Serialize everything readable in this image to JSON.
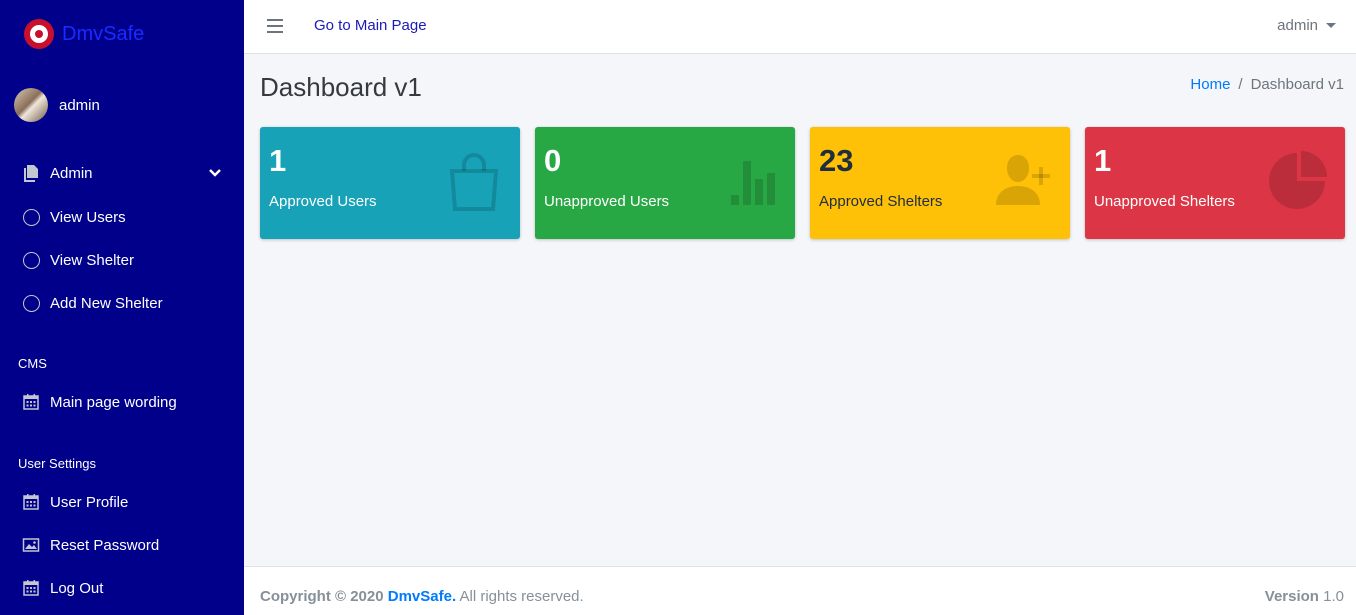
{
  "sidebar": {
    "brand": "DmvSafe",
    "user": "admin",
    "menu": [
      {
        "label": "Admin"
      },
      {
        "label": "View Users"
      },
      {
        "label": "View Shelter"
      },
      {
        "label": "Add New Shelter"
      }
    ],
    "cms_header": "CMS",
    "cms_items": [
      {
        "label": "Main page wording"
      }
    ],
    "settings_header": "User Settings",
    "settings_items": [
      {
        "label": "User Profile"
      },
      {
        "label": "Reset Password"
      },
      {
        "label": "Log Out"
      }
    ]
  },
  "topbar": {
    "main_link": "Go to Main Page",
    "user": "admin"
  },
  "content": {
    "title": "Dashboard v1",
    "breadcrumb": {
      "home": "Home",
      "separator": "/",
      "current": "Dashboard v1"
    }
  },
  "boxes": [
    {
      "value": "1",
      "label": "Approved Users",
      "color": "#17a2b8",
      "icon": "shopping-bag-icon"
    },
    {
      "value": "0",
      "label": "Unapproved Users",
      "color": "#28a745",
      "icon": "bar-chart-icon"
    },
    {
      "value": "23",
      "label": "Approved Shelters",
      "color": "#ffc107",
      "icon": "user-plus-icon"
    },
    {
      "value": "1",
      "label": "Unapproved Shelters",
      "color": "#dc3545",
      "icon": "pie-chart-icon"
    }
  ],
  "footer": {
    "copyright_prefix": "Copyright © 2020",
    "brand": "DmvSafe.",
    "rights": "All rights reserved.",
    "version_label": "Version",
    "version_value": "1.0"
  }
}
